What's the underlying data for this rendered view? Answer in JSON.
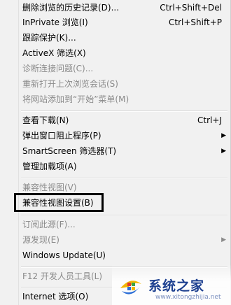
{
  "menu": {
    "items": [
      {
        "label": "删除浏览的历史记录(D)...",
        "shortcut": "Ctrl+Shift+Del",
        "disabled": false
      },
      {
        "label": "InPrivate 浏览(I)",
        "shortcut": "Ctrl+Shift+P",
        "disabled": false
      },
      {
        "label": "跟踪保护(K)...",
        "disabled": false
      },
      {
        "label": "ActiveX 筛选(X)",
        "disabled": false
      },
      {
        "label": "诊断连接问题(C)...",
        "disabled": true
      },
      {
        "label": "重新打开上次浏览会话(S)",
        "disabled": true
      },
      {
        "label": "将网站添加到“开始”菜单(M)",
        "disabled": true
      },
      {
        "label": "查看下载(N)",
        "shortcut": "Ctrl+J",
        "disabled": false
      },
      {
        "label": "弹出窗口阻止程序(P)",
        "submenu": true,
        "disabled": false
      },
      {
        "label": "SmartScreen 筛选器(T)",
        "submenu": true,
        "disabled": false
      },
      {
        "label": "管理加载项(A)",
        "disabled": false
      },
      {
        "label": "兼容性视图(V)",
        "disabled": true
      },
      {
        "label": "兼容性视图设置(B)",
        "disabled": false
      },
      {
        "label": "订阅此源(F)...",
        "disabled": true
      },
      {
        "label": "源发现(E)",
        "submenu": true,
        "disabled": true
      },
      {
        "label": "Windows Update(U)",
        "disabled": false
      },
      {
        "label": "F12 开发人员工具(L)",
        "disabled": true
      },
      {
        "label": "Internet 选项(O)",
        "disabled": false
      }
    ],
    "arrow_glyph": "▶"
  },
  "watermark": {
    "text": "系统之家",
    "sub": "www.xitongzhijia.net"
  }
}
